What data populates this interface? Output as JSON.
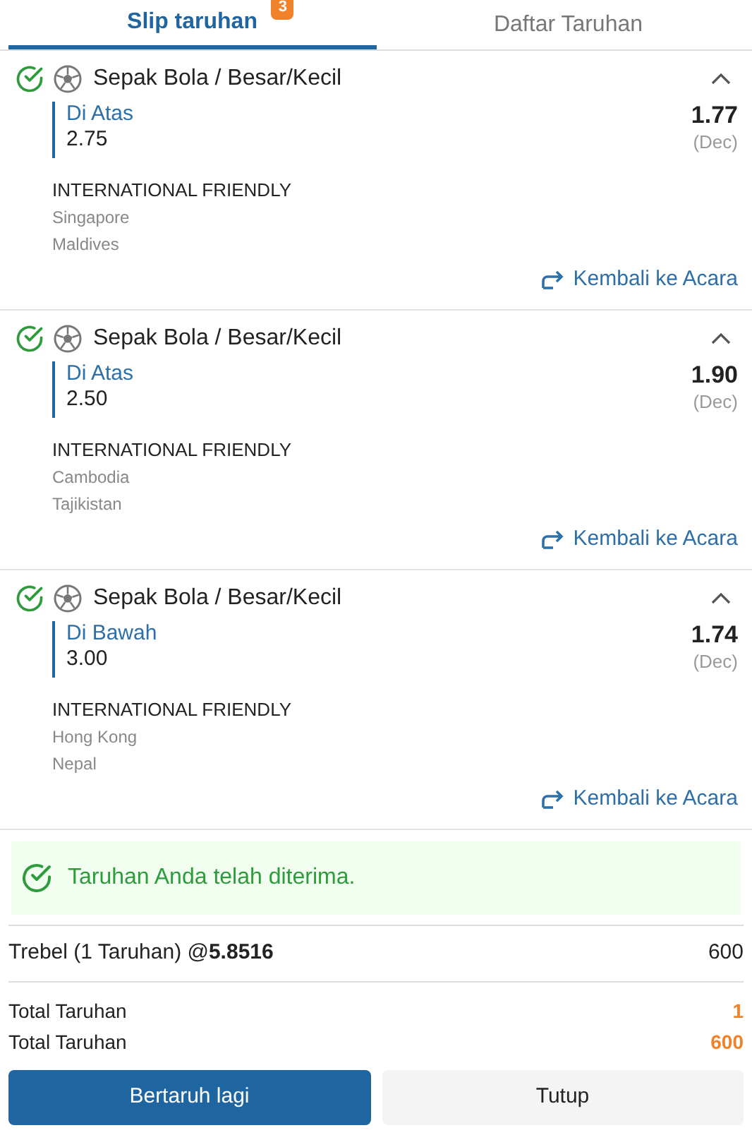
{
  "tabs": [
    {
      "label": "Slip taruhan",
      "badge": "3",
      "selected": true
    },
    {
      "label": "Daftar Taruhan",
      "selected": false
    }
  ],
  "bets": [
    {
      "title": "Sepak Bola / Besar/Kecil",
      "accepted": true,
      "expanded": true,
      "selection": "Di Atas",
      "line": "2.75",
      "odds": "1.77",
      "odds_format": "(Dec)",
      "league": "INTERNATIONAL FRIENDLY",
      "teams": [
        "Singapore",
        "Maldives"
      ],
      "link": "Kembali ke Acara"
    },
    {
      "title": "Sepak Bola / Besar/Kecil",
      "accepted": true,
      "expanded": true,
      "selection": "Di Atas",
      "line": "2.50",
      "odds": "1.90",
      "odds_format": "(Dec)",
      "league": "INTERNATIONAL FRIENDLY",
      "teams": [
        "Cambodia",
        "Tajikistan"
      ],
      "link": "Kembali ke Acara"
    },
    {
      "title": "Sepak Bola / Besar/Kecil",
      "accepted": true,
      "expanded": true,
      "selection": "Di Bawah",
      "line": "3.00",
      "odds": "1.74",
      "odds_format": "(Dec)",
      "league": "INTERNATIONAL FRIENDLY",
      "teams": [
        "Hong Kong",
        "Nepal"
      ],
      "link": "Kembali ke Acara"
    }
  ],
  "message": "Taruhan Anda telah diterima.",
  "combo": {
    "label": "Trebel (1 Taruhan) @**5.8516**",
    "amount": "600"
  },
  "totals": [
    {
      "label": "Total Taruhan",
      "value": "1"
    },
    {
      "label": "Total Taruhan",
      "value": "600"
    }
  ],
  "buttons": [
    {
      "label": "Bertaruh lagi",
      "kind": "primary"
    },
    {
      "label": "Tutup",
      "kind": "secondary"
    }
  ]
}
